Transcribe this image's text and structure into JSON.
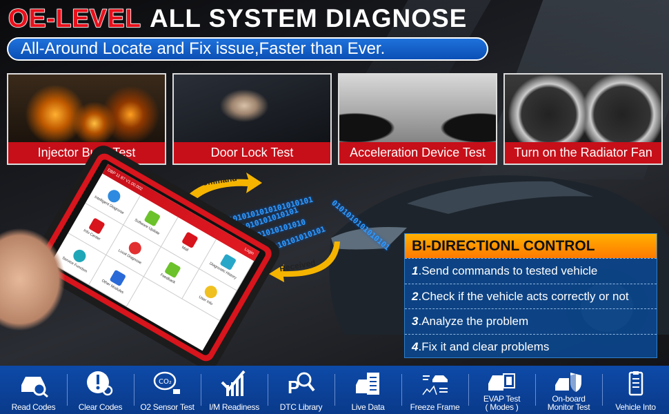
{
  "header": {
    "title_highlight": "OE-LEVEL",
    "title_rest": "ALL SYSTEM DIAGNOSE",
    "subtitle": "All-Around Locate and Fix issue,Faster than Ever."
  },
  "tiles": [
    {
      "label": "Injector Buzz Test"
    },
    {
      "label": "Door Lock Test"
    },
    {
      "label": "Acceleration Device Test"
    },
    {
      "label": "Turn on the Radiator Fan"
    }
  ],
  "arrows": {
    "command": "Command",
    "received": "Received"
  },
  "binary_stream": [
    "0101010101010101010101",
    "1010101010101010101010",
    "0101010101010101010101",
    "1101010101010101010101",
    "0101010101010101"
  ],
  "tablet": {
    "status": "DBP 11 87 V1.00.002",
    "login": "Login",
    "apps": [
      "Intelligent Diagnose",
      "Software Update",
      "Mall",
      "Diagnostic History",
      "Info Center",
      "Local Diagnose",
      "Feedback",
      "User Info",
      "Service Function",
      "Other Modules"
    ]
  },
  "bidirectional": {
    "title": "BI-DIRECTIONL CONTROL",
    "steps": [
      {
        "num": "1",
        "text": ".Send commands to tested vehicle"
      },
      {
        "num": "2",
        "text": ".Check if the vehicle acts correctly or not"
      },
      {
        "num": "3",
        "text": ".Analyze the problem"
      },
      {
        "num": "4",
        "text": ".Fix it and clear problems"
      }
    ]
  },
  "features": [
    {
      "label": "Read Codes",
      "icon": "car-search-icon"
    },
    {
      "label": "Clear Codes",
      "icon": "exclamation-search-icon"
    },
    {
      "label": "O2 Sensor Test",
      "icon": "co2-sensor-icon"
    },
    {
      "label": "I/M Readiness",
      "icon": "check-bars-icon"
    },
    {
      "label": "DTC Library",
      "icon": "p-code-search-icon"
    },
    {
      "label": "Live Data",
      "icon": "car-data-icon"
    },
    {
      "label": "Freeze Frame",
      "icon": "freeze-frame-icon"
    },
    {
      "label": "EVAP Test\n( Modes )",
      "icon": "car-chip-icon"
    },
    {
      "label": "On-board\nMonitor Test",
      "icon": "car-shield-icon"
    },
    {
      "label": "Vehicle Into",
      "icon": "clipboard-icon"
    }
  ],
  "colors": {
    "red": "#c70f19",
    "blue": "#0d4aa8",
    "orange": "#ff9000",
    "binary": "#2f9bff"
  }
}
